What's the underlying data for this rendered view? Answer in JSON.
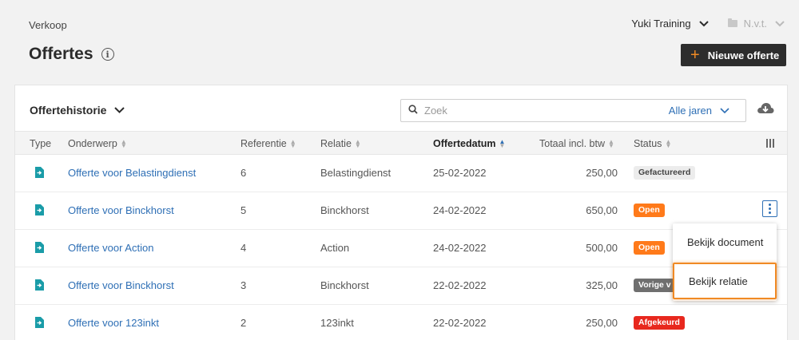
{
  "breadcrumb": "Verkoop",
  "title": "Offertes",
  "company": "Yuki Training",
  "period": "N.v.t.",
  "new_button": "Nieuwe offerte",
  "history_label": "Offertehistorie",
  "search": {
    "placeholder": "Zoek",
    "years": "Alle jaren"
  },
  "columns": {
    "type": "Type",
    "subject": "Onderwerp",
    "reference": "Referentie",
    "relation": "Relatie",
    "date": "Offertedatum",
    "total": "Totaal incl. btw",
    "status": "Status"
  },
  "rows": [
    {
      "subject": "Offerte voor Belastingdienst",
      "reference": "6",
      "relation": "Belastingdienst",
      "date": "25-02-2022",
      "total": "250,00",
      "status": "Gefactureerd"
    },
    {
      "subject": "Offerte voor Binckhorst",
      "reference": "5",
      "relation": "Binckhorst",
      "date": "24-02-2022",
      "total": "650,00",
      "status": "Open"
    },
    {
      "subject": "Offerte voor Action",
      "reference": "4",
      "relation": "Action",
      "date": "24-02-2022",
      "total": "500,00",
      "status": "Open"
    },
    {
      "subject": "Offerte voor Binckhorst",
      "reference": "3",
      "relation": "Binckhorst",
      "date": "22-02-2022",
      "total": "325,00",
      "status": "Vorige v"
    },
    {
      "subject": "Offerte voor 123inkt",
      "reference": "2",
      "relation": "123inkt",
      "date": "22-02-2022",
      "total": "250,00",
      "status": "Afgekeurd"
    }
  ],
  "context_menu": {
    "view_document": "Bekijk document",
    "view_relation": "Bekijk relatie"
  },
  "colors": {
    "accent": "#f08a24",
    "link": "#2e6fb5",
    "open": "#ff7a1a",
    "rejected": "#e8281e"
  }
}
